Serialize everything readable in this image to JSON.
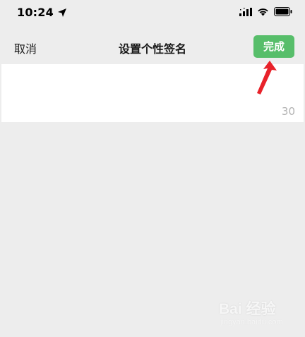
{
  "status_bar": {
    "time": "10:24",
    "icons": [
      "location-arrow-icon",
      "signal-icon",
      "wifi-icon",
      "battery-icon"
    ]
  },
  "nav": {
    "cancel_label": "取消",
    "title": "设置个性签名",
    "done_label": "完成"
  },
  "signature": {
    "value": "",
    "char_count": "30"
  },
  "watermark": {
    "logo_text": "Bai 经验",
    "sub_text": "jingyan.baidu.com"
  },
  "colors": {
    "background": "#ededed",
    "done_button": "#57be6a",
    "counter_text": "#b2b2b2",
    "annotation_arrow": "#e8222a"
  }
}
